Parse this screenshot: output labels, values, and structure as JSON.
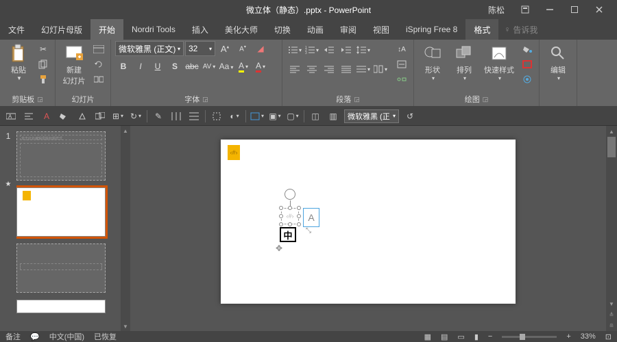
{
  "title": "微立体（静态）.pptx - PowerPoint",
  "user": "陈松",
  "menu": {
    "file": "文件",
    "master": "幻灯片母版",
    "home": "开始",
    "nordri": "Nordri Tools",
    "insert": "插入",
    "beautify": "美化大师",
    "transition": "切换",
    "animation": "动画",
    "review": "审阅",
    "view": "视图",
    "ispring": "iSpring Free 8",
    "format": "格式",
    "tellme": "告诉我"
  },
  "ribbon": {
    "clipboard": {
      "label": "剪贴板",
      "paste": "粘贴"
    },
    "slides": {
      "label": "幻灯片",
      "newslide": "新建\n幻灯片"
    },
    "font": {
      "label": "字体",
      "name": "微软雅黑 (正文)",
      "size": "32"
    },
    "paragraph": {
      "label": "段落"
    },
    "drawing": {
      "label": "绘图",
      "shapes": "形状",
      "arrange": "排列",
      "quickstyle": "快速样式"
    },
    "editing": {
      "label": "编辑"
    }
  },
  "qat_font": "微软雅黑 (正",
  "thumbs": {
    "num1": "1"
  },
  "ime": "中",
  "text_hint": "A",
  "placeholder_icon": "‹#›",
  "corner_icon": "‹#›",
  "status": {
    "notes": "备注",
    "lang": "中文(中国)",
    "recovered": "已恢复",
    "zoom": "33%"
  }
}
